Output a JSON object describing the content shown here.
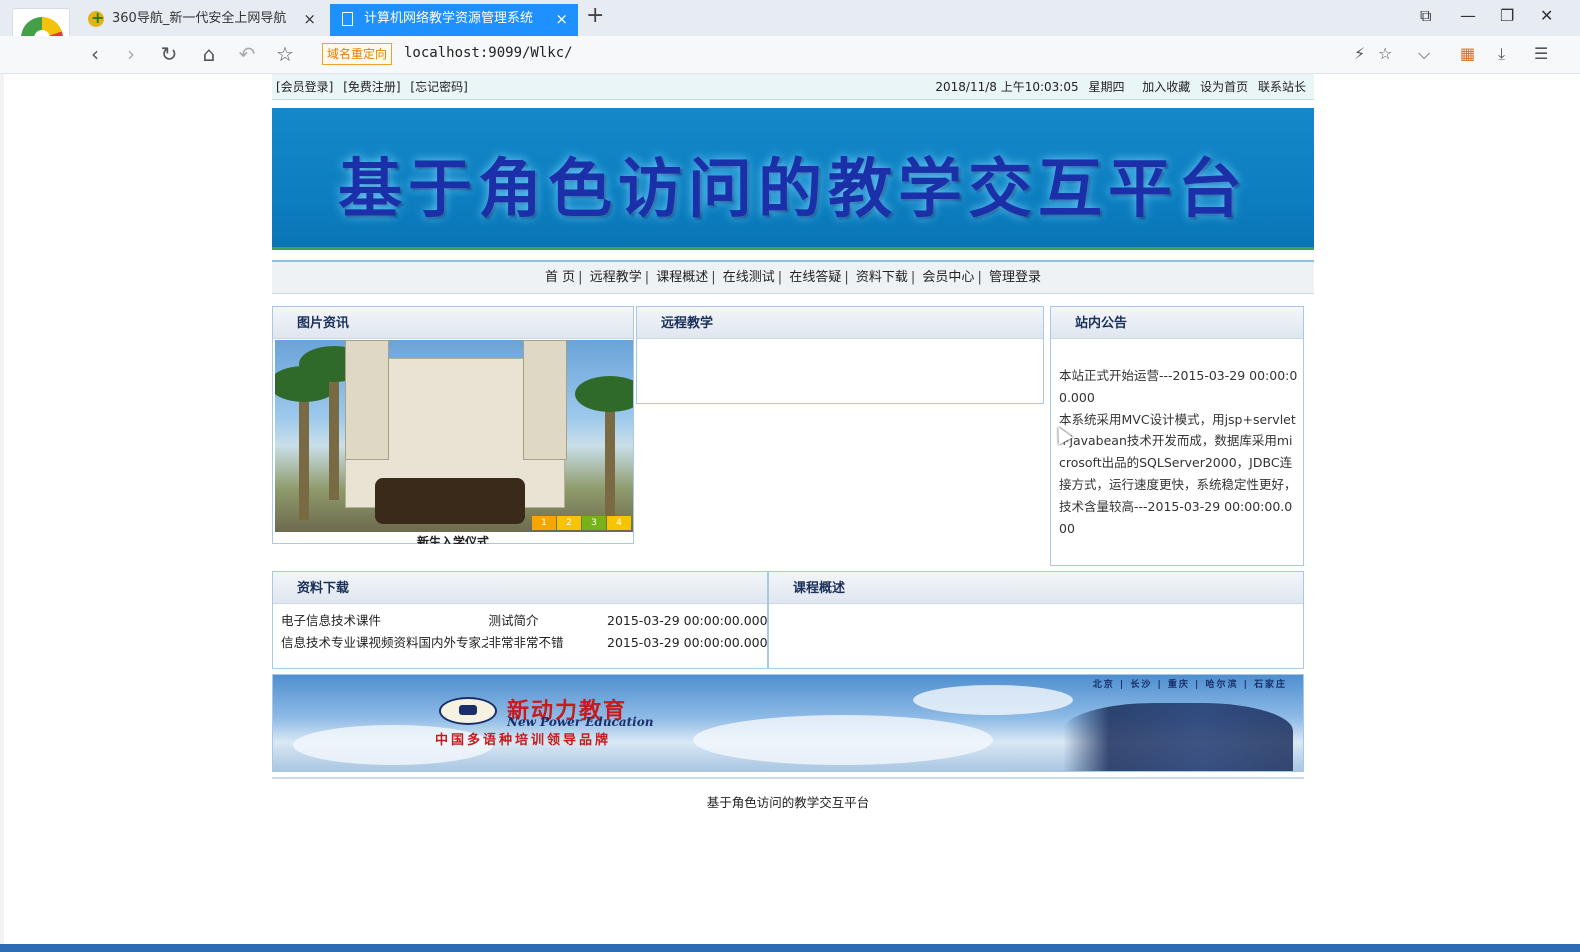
{
  "browser": {
    "tabs": [
      {
        "title": "360导航_新一代安全上网导航",
        "close": "×"
      },
      {
        "title": "计算机网络教学资源管理系统",
        "close": "×"
      }
    ],
    "new_tab": "+",
    "window": {
      "restore": "⧉",
      "minimize": "—",
      "maximize": "❐",
      "close": "✕"
    },
    "nav": {
      "back": "‹",
      "forward": "›",
      "reload": "↻",
      "home": "⌂",
      "undo": "↶",
      "bookmark": "☆"
    },
    "redirect_badge": "域名重定向",
    "url": "localhost:9099/Wlkc/",
    "tools": {
      "lightning": "⚡",
      "star": "☆",
      "dropdown": "⌵",
      "apps": "▦",
      "download": "⤓",
      "menu": "☰"
    }
  },
  "site": {
    "top_links": [
      "[会员登录]",
      "[免费注册]",
      "[忘记密码]"
    ],
    "datetime": "2018/11/8 上午10:03:05",
    "weekday": "星期四",
    "quick_links": [
      "加入收藏",
      "设为首页",
      "联系站长"
    ],
    "banner_title": "基于角色访问的教学交互平台",
    "nav": [
      "首 页",
      "远程教学",
      "课程概述",
      "在线测试",
      "在线答疑",
      "资料下载",
      "会员中心",
      "管理登录"
    ],
    "panels": {
      "photo": {
        "title": "图片资讯",
        "caption": "新生入学仪式",
        "dots": [
          "1",
          "2",
          "3",
          "4"
        ]
      },
      "remote": {
        "title": "远程教学"
      },
      "notice": {
        "title": "站内公告",
        "items": [
          "本站正式开始运营---2015-03-29 00:00:00.000",
          "本系统采用MVC设计模式，用jsp+servlet+javabean技术开发而成，数据库采用microsoft出品的SQLServer2000，JDBC连接方式，运行速度更快，系统稳定性更好，技术含量较高---2015-03-29 00:00:00.000"
        ]
      },
      "download": {
        "title": "资料下载",
        "rows": [
          {
            "title": "电子信息技术课件",
            "desc": "测试简介",
            "time": "2015-03-29 00:00:00.000"
          },
          {
            "title": "信息技术专业课视频资料国内外专家之精华",
            "desc": "非常非常不错",
            "time": "2015-03-29 00:00:00.000"
          }
        ]
      },
      "course": {
        "title": "课程概述"
      }
    },
    "footer_banner": {
      "brand": "新动力教育",
      "english": "New Power Education",
      "slogan": "中国多语种培训领导品牌",
      "cities": "北京 | 长沙 | 重庆 | 哈尔滨 | 石家庄"
    },
    "footer_text": "基于角色访问的教学交互平台"
  }
}
